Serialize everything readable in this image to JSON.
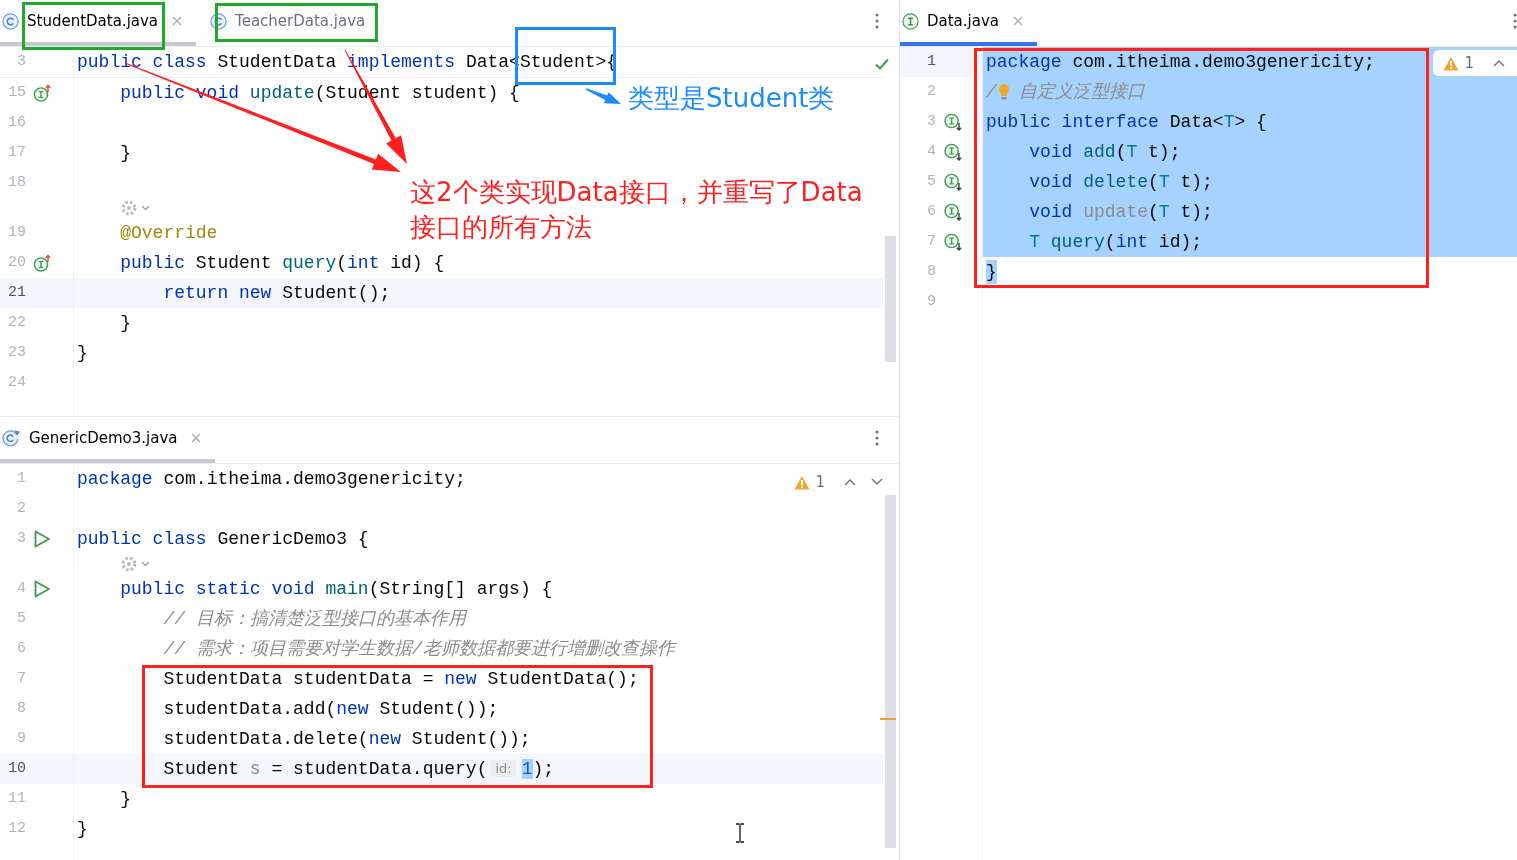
{
  "top_left_editor": {
    "focused": false,
    "tabs": [
      {
        "label": "StudentData.java",
        "kind": "class",
        "selected": true,
        "close": true
      },
      {
        "label": "TeacherData.java",
        "kind": "class",
        "selected": false,
        "close": false
      }
    ],
    "inspection": {
      "kind": "ok"
    },
    "sticky_line": {
      "number": "3",
      "current": false,
      "tokens": [
        {
          "text": "public class",
          "kind": "keyword"
        },
        {
          "text": " StudentData ",
          "kind": "plain"
        },
        {
          "text": "implements",
          "kind": "keyword"
        },
        {
          "text": " Data<Student>{",
          "kind": "plain"
        }
      ],
      "children": [
        {
          "kind": "implementing",
          "number": "15",
          "current": false,
          "tokens": [
            {
              "text": "public void ",
              "kind": "keyword"
            },
            {
              "text": "update",
              "kind": "method"
            },
            {
              "text": "(Student student) {",
              "kind": "plain"
            }
          ],
          "children": [
            {
              "kind": "code",
              "number": "16",
              "current": false
            }
          ]
        },
        {
          "kind": "code",
          "number": "17",
          "current": false,
          "tokens": [
            {
              "text": "}",
              "kind": "plain"
            }
          ]
        },
        {
          "kind": "code",
          "number": "18",
          "current": false
        },
        {
          "kind": "hint"
        },
        {
          "kind": "code",
          "number": "19",
          "current": false,
          "tokens": [
            {
              "text": "@Override",
              "kind": "annotation"
            }
          ]
        },
        {
          "kind": "implementing",
          "number": "20",
          "current": false,
          "tokens": [
            {
              "text": "public",
              "kind": "keyword"
            },
            {
              "text": " Student ",
              "kind": "plain"
            },
            {
              "text": "query",
              "kind": "method"
            },
            {
              "text": "(",
              "kind": "plain"
            },
            {
              "text": "int",
              "kind": "keyword"
            },
            {
              "text": " id) {",
              "kind": "plain"
            }
          ],
          "children": [
            {
              "kind": "code",
              "number": "21",
              "current": true,
              "tokens": [
                {
                  "text": "return new",
                  "kind": "keyword"
                },
                {
                  "text": " Student();",
                  "kind": "plain"
                }
              ]
            }
          ]
        },
        {
          "kind": "code",
          "number": "22",
          "current": false,
          "tokens": [
            {
              "text": "}",
              "kind": "plain"
            }
          ]
        }
      ]
    },
    "lines": [
      {
        "kind": "code",
        "number": "23",
        "current": false,
        "tokens": [
          {
            "text": "}",
            "kind": "plain"
          }
        ]
      },
      {
        "kind": "code",
        "number": "24",
        "current": false
      }
    ]
  },
  "bottom_left_editor": {
    "focused": false,
    "tabs": [
      {
        "label": "GenericDemo3.java",
        "kind": "runnable",
        "selected": true,
        "close": true
      }
    ],
    "inspection": {
      "kind": "warning",
      "count": "1",
      "up_button": true,
      "down_button": true
    },
    "lines": [
      {
        "kind": "code",
        "number": "1",
        "current": false,
        "tokens": [
          {
            "text": "package",
            "kind": "keyword"
          },
          {
            "text": " com.itheima.demo3genericity;",
            "kind": "plain"
          }
        ]
      },
      {
        "kind": "code",
        "number": "2",
        "current": false
      },
      {
        "kind": "runnable",
        "number": "3",
        "current": false,
        "tokens": [
          {
            "text": "public class",
            "kind": "keyword"
          },
          {
            "text": " GenericDemo3 {",
            "kind": "plain"
          }
        ],
        "children": [
          {
            "kind": "hint"
          },
          {
            "kind": "runnable",
            "number": "4",
            "current": false,
            "tokens": [
              {
                "text": "public static void ",
                "kind": "keyword"
              },
              {
                "text": "main",
                "kind": "method"
              },
              {
                "text": "(String[] args) {",
                "kind": "plain"
              }
            ],
            "children": [
              {
                "kind": "code",
                "number": "5",
                "current": false,
                "tokens": [
                  {
                    "text": "// 目标：搞清楚泛型接口的基本作用",
                    "kind": "comment"
                  }
                ]
              },
              {
                "kind": "code",
                "number": "6",
                "current": false,
                "tokens": [
                  {
                    "text": "// 需求：项目需要对学生数据/老师数据都要进行增删改查操作",
                    "kind": "comment"
                  }
                ]
              },
              {
                "kind": "code",
                "number": "7",
                "current": false,
                "tokens": [
                  {
                    "text": "StudentData studentData = ",
                    "kind": "plain"
                  },
                  {
                    "text": "new",
                    "kind": "keyword"
                  },
                  {
                    "text": " StudentData();",
                    "kind": "plain"
                  }
                ]
              },
              {
                "kind": "code",
                "number": "8",
                "current": false,
                "tokens": [
                  {
                    "text": "studentData.add(",
                    "kind": "plain"
                  },
                  {
                    "text": "new",
                    "kind": "keyword"
                  },
                  {
                    "text": " Student());",
                    "kind": "plain"
                  }
                ]
              },
              {
                "kind": "code",
                "number": "9",
                "current": false,
                "tokens": [
                  {
                    "text": "studentData.delete(",
                    "kind": "plain"
                  },
                  {
                    "text": "new",
                    "kind": "keyword"
                  },
                  {
                    "text": " Student());",
                    "kind": "plain"
                  }
                ]
              },
              {
                "kind": "code",
                "number": "10",
                "current": true,
                "tokens": [
                  {
                    "text": "Student ",
                    "kind": "plain"
                  },
                  {
                    "text": "s",
                    "kind": "unused"
                  },
                  {
                    "text": " = studentData.query(",
                    "kind": "plain"
                  },
                  {
                    "text": "id:",
                    "kind": "hint"
                  },
                  {
                    "text": "1",
                    "kind": "highlight"
                  },
                  {
                    "text": ");",
                    "kind": "plain"
                  }
                ]
              }
            ]
          },
          {
            "kind": "code",
            "number": "11",
            "current": false,
            "tokens": [
              {
                "text": "}",
                "kind": "plain"
              }
            ]
          }
        ]
      },
      {
        "kind": "code",
        "number": "12",
        "current": false,
        "tokens": [
          {
            "text": "}",
            "kind": "plain"
          }
        ]
      }
    ]
  },
  "right_editor": {
    "focused": true,
    "tabs": [
      {
        "label": "Data.java",
        "kind": "interface",
        "selected": true,
        "close": true
      }
    ],
    "inspection": {
      "kind": "warning",
      "count": "1",
      "up_button": true
    },
    "lines": [
      {
        "kind": "code",
        "number": "1",
        "current": true,
        "selected": true,
        "tokens": [
          {
            "text": "package",
            "kind": "keyword"
          },
          {
            "text": " com.itheima.demo3genericity;",
            "kind": "plain"
          }
        ]
      },
      {
        "kind": "code",
        "number": "2",
        "current": false,
        "selected": true,
        "tokens": [
          {
            "text": "/",
            "kind": "comment"
          },
          {
            "kind": "bulb"
          },
          {
            "text": "自定义泛型接口",
            "kind": "comment"
          }
        ]
      },
      {
        "kind": "implemented",
        "number": "3",
        "current": false,
        "selected": true,
        "tokens": [
          {
            "text": "public interface",
            "kind": "keyword"
          },
          {
            "text": " Data<",
            "kind": "plain"
          },
          {
            "text": "T",
            "kind": "type"
          },
          {
            "text": "> {",
            "kind": "plain"
          }
        ],
        "children": [
          {
            "kind": "implemented",
            "number": "4",
            "current": false,
            "selected": true,
            "tokens": [
              {
                "text": "void ",
                "kind": "keyword"
              },
              {
                "text": "add",
                "kind": "method"
              },
              {
                "text": "(",
                "kind": "plain"
              },
              {
                "text": "T",
                "kind": "type"
              },
              {
                "text": " t);",
                "kind": "plain"
              }
            ]
          },
          {
            "kind": "implemented",
            "number": "5",
            "current": false,
            "selected": true,
            "tokens": [
              {
                "text": "void ",
                "kind": "keyword"
              },
              {
                "text": "delete",
                "kind": "method"
              },
              {
                "text": "(",
                "kind": "plain"
              },
              {
                "text": "T",
                "kind": "type"
              },
              {
                "text": " t);",
                "kind": "plain"
              }
            ]
          },
          {
            "kind": "implemented",
            "number": "6",
            "current": false,
            "selected": true,
            "tokens": [
              {
                "text": "void ",
                "kind": "keyword"
              },
              {
                "text": "update",
                "kind": "unused"
              },
              {
                "text": "(",
                "kind": "plain"
              },
              {
                "text": "T",
                "kind": "type"
              },
              {
                "text": " t);",
                "kind": "plain"
              }
            ]
          },
          {
            "kind": "implemented",
            "number": "7",
            "current": false,
            "selected": true,
            "tokens": [
              {
                "text": "T ",
                "kind": "type"
              },
              {
                "text": "query",
                "kind": "method"
              },
              {
                "text": "(",
                "kind": "plain"
              },
              {
                "text": "int",
                "kind": "keyword"
              },
              {
                "text": " id);",
                "kind": "plain"
              }
            ]
          }
        ]
      },
      {
        "kind": "code",
        "number": "8",
        "current": false,
        "selected": true,
        "tokens": [
          {
            "text": "}",
            "kind": "plain"
          }
        ]
      },
      {
        "kind": "code",
        "number": "9",
        "current": false,
        "selected": false
      }
    ]
  },
  "annotations": [
    {
      "kind": "frame",
      "color": "#22a82c"
    },
    {
      "kind": "frame",
      "color": "#22a82c"
    },
    {
      "kind": "frame",
      "color": "#1a8cff"
    },
    {
      "kind": "arrow",
      "color": "#1a8cff"
    },
    {
      "kind": "note",
      "text": "类型是Student类",
      "color": "#1a8cff"
    },
    {
      "kind": "arrow",
      "color": "#ff1f1f"
    },
    {
      "kind": "arrow",
      "color": "#ff1f1f"
    },
    {
      "kind": "note",
      "text": "这2个类实现Data接口，并重写了Data接口的所有方法",
      "color": "#ff1f1f"
    },
    {
      "kind": "frame",
      "color": "#ff1f1f"
    },
    {
      "kind": "frame",
      "color": "#ff1f1f"
    }
  ]
}
